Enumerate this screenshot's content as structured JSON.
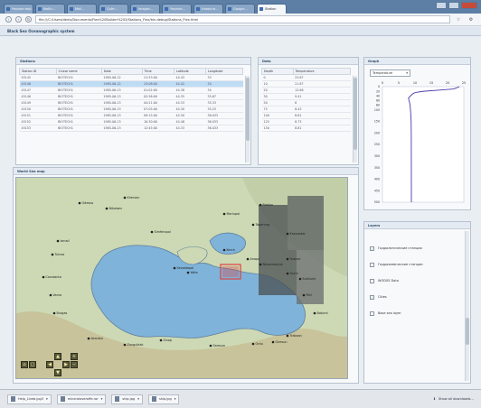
{
  "browser": {
    "tabs": [
      {
        "label": "Черное мор…",
        "active": false
      },
      {
        "label": "Файл…",
        "active": false
      },
      {
        "label": "Mail…",
        "active": false
      },
      {
        "label": "Сайт…",
        "active": false
      },
      {
        "label": "Images…",
        "active": false
      },
      {
        "label": "Черное…",
        "active": false
      },
      {
        "label": "Новости…",
        "active": false
      },
      {
        "label": "Google…",
        "active": false
      },
      {
        "label": "Station",
        "active": true
      }
    ],
    "url": "file:///C:/Users/denis/Documents/Flex%20Builder%203/Stations_Flex/bin-debug/Stations_Flex.html"
  },
  "app": {
    "title": "Black Sea Oceanographic system"
  },
  "stations": {
    "title": "Stations",
    "columns": [
      "Station ID",
      "Cruise name",
      "Date",
      "Time",
      "Latitude",
      "Longitude"
    ],
    "rows": [
      [
        "45145",
        "BIOTECH1",
        "1985-06-12",
        "21:53:00",
        "44.43",
        "33"
      ],
      [
        "45146",
        "BIOTECH1",
        "1985-06-12",
        "23:08:00",
        "44.42",
        "34"
      ],
      [
        "45147",
        "BIOTECH1",
        "1985-06-13",
        "01:02:00",
        "44.38",
        "34"
      ],
      [
        "45148",
        "BIOTECH1",
        "1985-06-13",
        "02:56:00",
        "44.35",
        "35.67"
      ],
      [
        "45149",
        "BIOTECH1",
        "1985-06-13",
        "04:21:00",
        "44.33",
        "35.33"
      ],
      [
        "45150",
        "BIOTECH1",
        "1985-06-13",
        "07:05:00",
        "44.30",
        "35.25"
      ],
      [
        "45151",
        "BIOTECH1",
        "1985-06-13",
        "09:15:00",
        "44.30",
        "36.033"
      ],
      [
        "45152",
        "BIOTECH1",
        "1985-06-13",
        "10:30:00",
        "44.48",
        "36.033"
      ],
      [
        "45153",
        "BIOTECH1",
        "1985-06-13",
        "12:45:00",
        "44.33",
        "36.033"
      ]
    ],
    "selected_index": 1
  },
  "data_panel": {
    "title": "Data",
    "columns": [
      "Depth",
      "Temperature"
    ],
    "rows": [
      [
        "0",
        "23.67"
      ],
      [
        "10",
        "21.87"
      ],
      [
        "20",
        "12.68"
      ],
      [
        "30",
        "9.41"
      ],
      [
        "50",
        "8"
      ],
      [
        "75",
        "8.43"
      ],
      [
        "100",
        "8.61"
      ],
      [
        "125",
        "8.73"
      ],
      [
        "150",
        "8.81"
      ]
    ]
  },
  "graph": {
    "title": "Graph",
    "select_value": "Temperature"
  },
  "map": {
    "title": "World Sea map",
    "places": [
      "Odessa",
      "Kherson",
      "Nikolaev",
      "Constanta",
      "Varna",
      "Burgas",
      "Istanbul",
      "Samsun",
      "Trabzon",
      "Batumi",
      "Sochi",
      "Novorossiysk",
      "Sevastopol",
      "Yalta",
      "Kerch",
      "Mariupol",
      "Rostov",
      "Sinop",
      "Zonguldak",
      "Krasnodar",
      "Simferopol",
      "Poti",
      "Sukhumi",
      "Tuapse",
      "Anapa",
      "Taganrog",
      "Izmail",
      "Tulcea",
      "Ordu",
      "Giresun"
    ],
    "colors": {
      "sea": "#7fb3d9",
      "land": "#cdd9b4",
      "coast": "#5f7f9e",
      "selection": "#e04040"
    }
  },
  "layers": {
    "title": "Layers",
    "items": [
      {
        "label": "Гидрологические станции",
        "checked": true
      },
      {
        "label": "Гидрохимические станции",
        "checked": false
      },
      {
        "label": "WOD05 Data",
        "checked": false
      },
      {
        "label": "Cities",
        "checked": true
      },
      {
        "label": "Base sea layer",
        "checked": false
      }
    ]
  },
  "downloads": [
    {
      "label": "Help_Lineb.jpg3"
    },
    {
      "label": "mineraloveroffe.rar"
    },
    {
      "label": "ship.jpg"
    },
    {
      "label": "ship.jpg"
    }
  ],
  "statusbar": {
    "show_all": "Show all downloads…"
  },
  "chart_data": {
    "type": "line",
    "title": "",
    "xlabel": "",
    "ylabel": "",
    "x_ticks": [
      "0",
      "5",
      "10",
      "15",
      "20",
      "25"
    ],
    "y_ticks": [
      "0",
      "20",
      "40",
      "60",
      "80",
      "100",
      "150",
      "200",
      "250",
      "300",
      "350",
      "400",
      "450",
      "500"
    ],
    "xlim": [
      0,
      25
    ],
    "ylim": [
      0,
      500
    ],
    "y_inverted": true,
    "series": [
      {
        "x": [
          23.67,
          21.87,
          17.5,
          12.68,
          10.2,
          9.41,
          8.6,
          8.0,
          8.43,
          8.61,
          8.73,
          8.81,
          8.85,
          8.87,
          8.88,
          8.89
        ],
        "y": [
          0,
          10,
          15,
          20,
          25,
          30,
          40,
          50,
          75,
          100,
          125,
          150,
          200,
          300,
          400,
          500
        ]
      }
    ],
    "colors": [
      "#4a3aa8"
    ]
  }
}
